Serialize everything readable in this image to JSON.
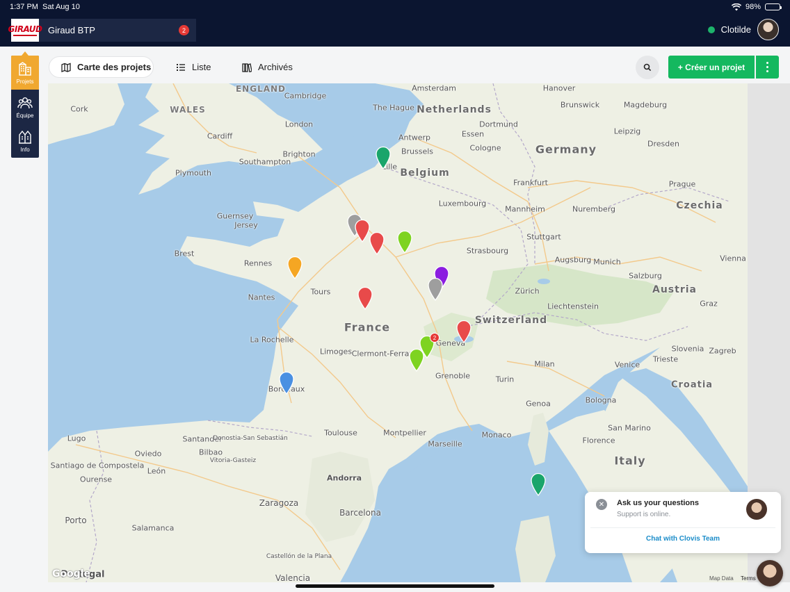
{
  "status_bar": {
    "time": "1:37 PM",
    "date": "Sat Aug 10",
    "battery": "98%"
  },
  "company": {
    "logo_text": "GIRAUD",
    "name": "Giraud BTP",
    "notifications": "2"
  },
  "user": {
    "name": "Clotilde",
    "status_color": "#1db36b"
  },
  "sidebar": {
    "items": [
      {
        "label": "Projets",
        "icon": "buildings-icon",
        "active": true
      },
      {
        "label": "Équipe",
        "icon": "team-icon",
        "active": false
      },
      {
        "label": "Info",
        "icon": "info-buildings-icon",
        "active": false
      }
    ]
  },
  "toolbar": {
    "tabs": [
      {
        "label": "Carte des projets",
        "icon": "map-icon",
        "active": true
      },
      {
        "label": "Liste",
        "icon": "list-icon",
        "active": false
      },
      {
        "label": "Archivés",
        "icon": "archive-icon",
        "active": false
      }
    ],
    "create_label": "+ Créer un projet",
    "accent": "#14b85f"
  },
  "map": {
    "countries": [
      {
        "name": "Germany"
      },
      {
        "name": "France"
      },
      {
        "name": "Belgium"
      },
      {
        "name": "Netherlands"
      },
      {
        "name": "Switzerland"
      },
      {
        "name": "Austria"
      },
      {
        "name": "Czechia"
      },
      {
        "name": "Italy"
      },
      {
        "name": "Croatia"
      },
      {
        "name": "Slovenia"
      },
      {
        "name": "Andorra"
      },
      {
        "name": "Monaco"
      },
      {
        "name": "San Marino"
      },
      {
        "name": "Portugal"
      },
      {
        "name": "Liechtenstein"
      },
      {
        "name": "Luxembourg"
      }
    ],
    "regions": [
      {
        "name": "ENGLAND"
      },
      {
        "name": "WALES"
      }
    ],
    "cities": [
      "Amsterdam",
      "Hanover",
      "Cambridge",
      "Brunswick",
      "Magdeburg",
      "The Hague",
      "Dortmund",
      "Essen",
      "Leipzig",
      "London",
      "Cork",
      "Cardiff",
      "Cologne",
      "Antwerp",
      "Brussels",
      "Brighton",
      "Southampton",
      "Plymouth",
      "Dresden",
      "Frankfurt",
      "Prague",
      "Lille",
      "Mannheim",
      "Nuremberg",
      "Guernsey",
      "Jersey",
      "Stuttgart",
      "Strasbourg",
      "Brest",
      "Rennes",
      "Augsburg",
      "Munich",
      "Vienna",
      "Salzburg",
      "Tours",
      "Nantes",
      "Zürich",
      "Graz",
      "La Rochelle",
      "Limoges",
      "Clermont-Ferrand",
      "Geneva",
      "Milan",
      "Venice",
      "Trieste",
      "Zagreb",
      "Grenoble",
      "Turin",
      "Bordeaux",
      "Genoa",
      "Bologna",
      "Toulouse",
      "Montpellier",
      "Marseille",
      "Florence",
      "Lugo",
      "Oviedo",
      "Santander",
      "Donostia-San Sebastián",
      "Bilbao",
      "Vitoria-Gasteiz",
      "Santiago de Compostela",
      "León",
      "Ourense",
      "Zaragoza",
      "Porto",
      "Salamanca",
      "Barcelona",
      "Castellón de la Plana",
      "Valencia"
    ],
    "pins": [
      {
        "color": "#1aa56b",
        "label": ""
      },
      {
        "color": "#9e9e9e",
        "label": ""
      },
      {
        "color": "#e84a4a",
        "label": ""
      },
      {
        "color": "#e84a4a",
        "label": ""
      },
      {
        "color": "#7ed321",
        "label": ""
      },
      {
        "color": "#f5a623",
        "label": ""
      },
      {
        "color": "#8b1de0",
        "label": ""
      },
      {
        "color": "#9e9e9e",
        "label": ""
      },
      {
        "color": "#e84a4a",
        "label": ""
      },
      {
        "color": "#e84a4a",
        "label": ""
      },
      {
        "color": "#7ed321",
        "label": "2"
      },
      {
        "color": "#7ed321",
        "label": ""
      },
      {
        "color": "#4a90e2",
        "label": ""
      },
      {
        "color": "#1aa56b",
        "label": ""
      }
    ],
    "attribution": {
      "logo": "Google",
      "map_data": "Map Data",
      "terms": "Terms"
    }
  },
  "chat": {
    "title": "Ask us your questions",
    "subtitle": "Support is online.",
    "link": "Chat with Clovis Team"
  }
}
